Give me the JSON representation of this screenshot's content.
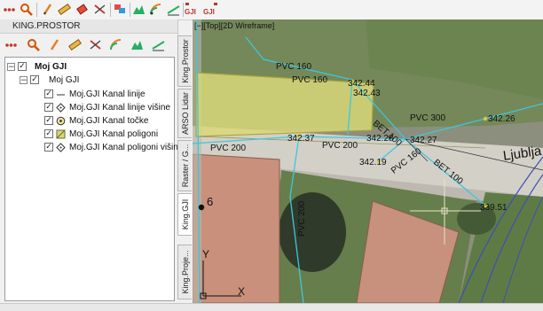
{
  "toolbar": {
    "icons": [
      "dots-icon",
      "search-icon",
      "pencil-icon",
      "ruler-icon",
      "eraser-icon",
      "layers-icon",
      "split-icon",
      "mountain-icon",
      "signal-icon",
      "line-icon",
      "gji-import-icon",
      "gji-export-icon"
    ],
    "gji_import_label": "GJI",
    "gji_export_label": "GJI"
  },
  "panel": {
    "title": "KING.PROSTOR",
    "tree": [
      {
        "label": "Moj GJI",
        "level": 0,
        "checked": true,
        "expanded": true,
        "icon": "none",
        "bold": true
      },
      {
        "label": "Moj GJI",
        "level": 1,
        "checked": true,
        "expanded": true,
        "icon": "none",
        "bold": false
      },
      {
        "label": "Moj.GJI Kanal linije",
        "level": 2,
        "checked": true,
        "icon": "line-icon"
      },
      {
        "label": "Moj.GJI Kanal linije višine",
        "level": 2,
        "checked": true,
        "icon": "diamond-icon"
      },
      {
        "label": "Moj.GJI Kanal točke",
        "level": 2,
        "checked": true,
        "icon": "point-icon"
      },
      {
        "label": "Moj.GJI Kanal poligoni",
        "level": 2,
        "checked": true,
        "icon": "polygon-icon"
      },
      {
        "label": "Moj.GJI Kanal poligoni višine",
        "level": 2,
        "checked": true,
        "icon": "diamond-icon"
      }
    ]
  },
  "vtabs": [
    "King.Prostor",
    "ARSO Lidar",
    "Raster / G...",
    "King.GJI",
    "King.Proje..."
  ],
  "map": {
    "viewport_label": "[−][Top][2D Wireframe]",
    "pipe_labels": [
      "PVC 160",
      "PVC 160",
      "PVC 300",
      "BET 100",
      "PVC 200",
      "PVC 200",
      "PVC 160",
      "BET 100",
      "PVC 200"
    ],
    "elevations": [
      "342.44",
      "342.43",
      "342.26",
      "342.37",
      "342.28",
      "342.27",
      "342.19",
      "339.51"
    ],
    "point_label": "6",
    "street_label": "Ljublja",
    "axis_y": "Y",
    "axis_x": "X"
  },
  "colors": {
    "pipe_cyan": "#3fc6dc",
    "polygon_fill": "#d9d77a",
    "polygon_stroke": "#a9a43a",
    "roof": "#c98f7c",
    "grass": "#6e8a50",
    "road": "#d7d4cd",
    "street_line": "#3b4fb8"
  }
}
